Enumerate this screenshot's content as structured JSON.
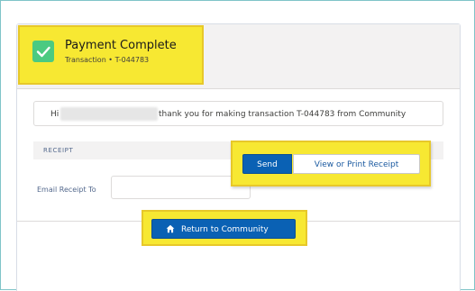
{
  "header": {
    "title": "Payment Complete",
    "subtitle": "Transaction • T-044783",
    "icon": "check-icon"
  },
  "message": {
    "greeting": "Hi",
    "text": "thank you for making transaction T-044783 from Community"
  },
  "receipt": {
    "section_label": "RECEIPT",
    "email_label": "Email Receipt To",
    "email_value": "",
    "send_label": "Send",
    "print_label": "View or Print Receipt"
  },
  "footer": {
    "return_label": "Return to Community",
    "icon": "home-icon"
  },
  "colors": {
    "highlight": "#f7e832",
    "primary": "#0a61b4",
    "success": "#4bca81"
  }
}
